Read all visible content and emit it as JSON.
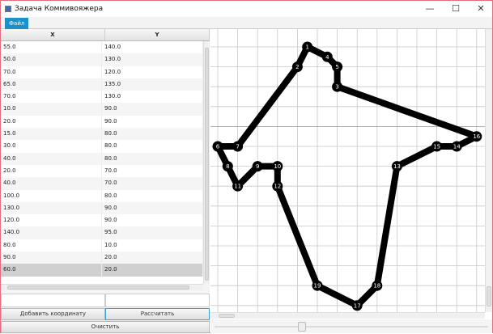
{
  "window": {
    "title": "Задача Коммивояжера",
    "minimize": "—",
    "maximize": "☐",
    "close": "✕"
  },
  "menu": {
    "file": "Файл"
  },
  "table": {
    "columns": [
      "X",
      "Y"
    ],
    "rows": [
      [
        "55.0",
        "140.0"
      ],
      [
        "50.0",
        "130.0"
      ],
      [
        "70.0",
        "120.0"
      ],
      [
        "65.0",
        "135.0"
      ],
      [
        "70.0",
        "130.0"
      ],
      [
        "10.0",
        "90.0"
      ],
      [
        "20.0",
        "90.0"
      ],
      [
        "15.0",
        "80.0"
      ],
      [
        "30.0",
        "80.0"
      ],
      [
        "40.0",
        "80.0"
      ],
      [
        "20.0",
        "70.0"
      ],
      [
        "40.0",
        "70.0"
      ],
      [
        "100.0",
        "80.0"
      ],
      [
        "130.0",
        "90.0"
      ],
      [
        "120.0",
        "90.0"
      ],
      [
        "140.0",
        "95.0"
      ],
      [
        "80.0",
        "10.0"
      ],
      [
        "90.0",
        "20.0"
      ],
      [
        "60.0",
        "20.0"
      ]
    ],
    "selected_row": 18
  },
  "buttons": {
    "add": "Добавить координату",
    "calculate": "Рассчитать",
    "clear": "Очистить"
  },
  "route": [
    1,
    4,
    5,
    3,
    16,
    14,
    15,
    13,
    18,
    17,
    19,
    12,
    10,
    9,
    11,
    8,
    6,
    7,
    2,
    1
  ],
  "colors": {
    "accent": "#1e90c8",
    "path": "#000000",
    "grid": "#c8c8c8"
  }
}
